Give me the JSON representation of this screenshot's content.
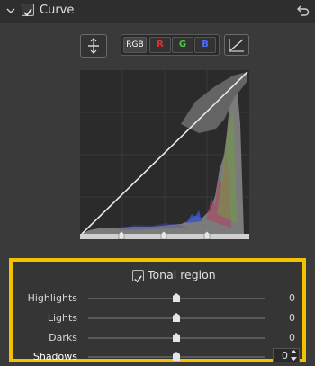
{
  "header": {
    "title": "Curve",
    "enabled": true
  },
  "toolbar": {
    "channels": [
      {
        "id": "rgb",
        "label": "RGB",
        "color": "#ffffff",
        "active": true
      },
      {
        "id": "r",
        "label": "R",
        "color": "#e23030",
        "active": false
      },
      {
        "id": "g",
        "label": "G",
        "color": "#3fcf3f",
        "active": false
      },
      {
        "id": "b",
        "label": "B",
        "color": "#4a6cff",
        "active": false
      }
    ]
  },
  "tonal_region": {
    "title": "Tonal region",
    "enabled": true,
    "accent_color": "#f2c200",
    "sliders": [
      {
        "label": "Highlights",
        "value": "0"
      },
      {
        "label": "Lights",
        "value": "0"
      },
      {
        "label": "Darks",
        "value": "0"
      },
      {
        "label": "Shadows",
        "value": "0"
      }
    ]
  }
}
